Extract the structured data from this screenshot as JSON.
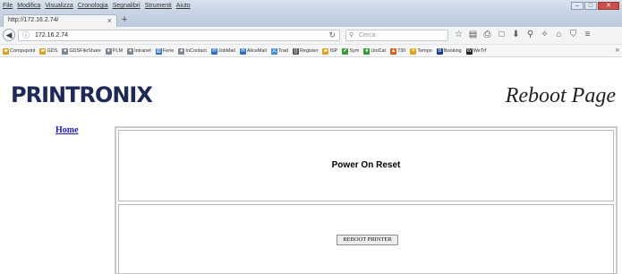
{
  "browser": {
    "menu": [
      "File",
      "Modifica",
      "Visualizza",
      "Cronologia",
      "Segnalibri",
      "Strumenti",
      "Aiuto"
    ],
    "window_controls": {
      "minimize": "–",
      "maximize": "□",
      "close": "✕"
    },
    "tab": {
      "title": "http://172.16.2.74/",
      "close": "×"
    },
    "new_tab": "+",
    "url": "172.16.2.74",
    "search_placeholder": "Cerca",
    "toolbar_icons": [
      "star-icon",
      "library-icon",
      "print-icon",
      "pocket-icon",
      "download-icon",
      "search-icon",
      "extension-icon",
      "home-icon",
      "shield-icon",
      "menu-icon"
    ]
  },
  "bookmarks": [
    {
      "label": "Compuprint",
      "icon": "folder-icon",
      "color": "#d9a321"
    },
    {
      "label": "GDS",
      "icon": "folder-icon",
      "color": "#d9a321"
    },
    {
      "label": "GDSFileShare",
      "icon": "globe-icon",
      "color": "#7c8796"
    },
    {
      "label": "PLM",
      "icon": "globe-icon",
      "color": "#7c8796"
    },
    {
      "label": "Intranet",
      "icon": "globe-icon",
      "color": "#7c8796"
    },
    {
      "label": "Ferie",
      "icon": "chart-icon",
      "color": "#2f6fbf"
    },
    {
      "label": "InContact",
      "icon": "globe-icon",
      "color": "#7c8796"
    },
    {
      "label": "JobMail",
      "icon": "mail-icon",
      "color": "#2f6fbf"
    },
    {
      "label": "AliceMail",
      "icon": "mail-icon",
      "color": "#2f6fbf"
    },
    {
      "label": "Trad",
      "icon": "translate-icon",
      "color": "#3a8ad8"
    },
    {
      "label": "Register",
      "icon": "brackets-icon",
      "color": "#555555"
    },
    {
      "label": "ISP",
      "icon": "folder-icon",
      "color": "#d9a321"
    },
    {
      "label": "Sym",
      "icon": "check-icon",
      "color": "#3a9a3a"
    },
    {
      "label": "UniCat",
      "icon": "globe-icon",
      "color": "#3a9a3a"
    },
    {
      "label": "730",
      "icon": "warning-icon",
      "color": "#d8601c"
    },
    {
      "label": "Tempo",
      "icon": "sun-icon",
      "color": "#e0a010"
    },
    {
      "label": "Booking",
      "icon": "booking-icon",
      "color": "#1b3d8f"
    },
    {
      "label": "WeTrf",
      "icon": "wetransfer-icon",
      "color": "#222222"
    }
  ],
  "page": {
    "logo": "PRINTRONIX",
    "title": "Reboot Page",
    "nav_home": "Home",
    "reset_heading": "Power On Reset",
    "reboot_button": "REBOOT PRINTER"
  }
}
